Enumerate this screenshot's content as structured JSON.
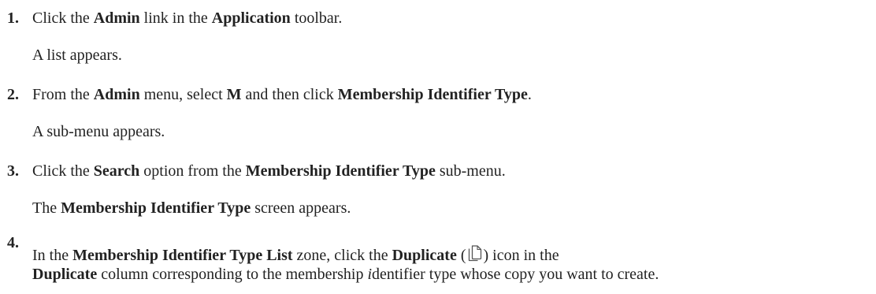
{
  "steps": [
    {
      "number": "1.",
      "instruction": {
        "t1": "Click the ",
        "b1": "Admin",
        "t2": " link in the ",
        "b2": "Application",
        "t3": " toolbar."
      },
      "result": "A list appears."
    },
    {
      "number": "2.",
      "instruction": {
        "t1": "From the ",
        "b1": "Admin",
        "t2": " menu, select ",
        "b2": "M",
        "t3": " and then click ",
        "b3": "Membership Identifier Type",
        "t4": "."
      },
      "result": "A sub-menu appears."
    },
    {
      "number": "3.",
      "instruction": {
        "t1": "Click the ",
        "b1": "Search",
        "t2": " option from the ",
        "b2": "Membership Identifier Type",
        "t3": " sub-menu."
      },
      "result": {
        "t1": "The ",
        "b1": "Membership Identifier Type",
        "t2": " screen appears."
      }
    },
    {
      "number": "4.",
      "instruction": {
        "t1": "In the ",
        "b1": "Membership Identifier Type List",
        "t2": " zone, click the ",
        "b2": "Duplicate",
        "t3": " (",
        "icon": "duplicate-icon",
        "t4": ") icon in the",
        "b3": "Duplicate",
        "t5": " column corresponding to the membership ",
        "i1": "i",
        "t6": "dentifier type whose copy you want to create."
      }
    }
  ]
}
